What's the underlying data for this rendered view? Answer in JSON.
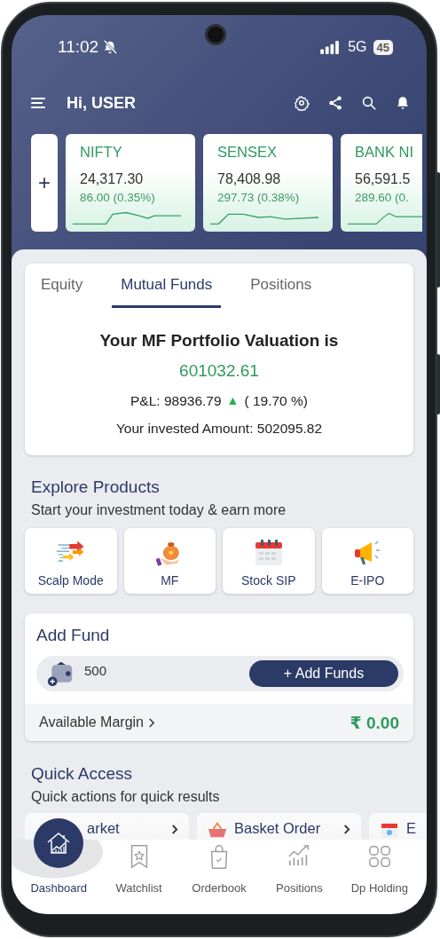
{
  "status_bar": {
    "time": "11:02",
    "network": "5G",
    "battery": "45"
  },
  "header": {
    "greeting": "Hi, USER"
  },
  "indices": [
    {
      "name": "NIFTY",
      "value": "24,317.30",
      "change": "86.00 (0.35%)"
    },
    {
      "name": "SENSEX",
      "value": "78,408.98",
      "change": "297.73 (0.38%)"
    },
    {
      "name": "BANK NI",
      "value": "56,591.5",
      "change": "289.60 (0."
    }
  ],
  "add_index": {
    "label": "+"
  },
  "portfolio": {
    "tabs": [
      {
        "label": "Equity",
        "selected": false
      },
      {
        "label": "Mutual Funds",
        "selected": true
      },
      {
        "label": "Positions",
        "selected": false
      }
    ],
    "title": "Your MF Portfolio Valuation is",
    "valuation": "601032.61",
    "pnl_label": "P&L: 98936.79",
    "pnl_arrow": "▲",
    "pnl_percent": "( 19.70 %)",
    "invested": "Your invested Amount: 502095.82"
  },
  "explore": {
    "title": "Explore Products",
    "subtitle": "Start your investment today & earn more",
    "products": [
      {
        "label": "Scalp Mode"
      },
      {
        "label": "MF"
      },
      {
        "label": "Stock SIP"
      },
      {
        "label": "E-IPO"
      }
    ]
  },
  "add_fund": {
    "title": "Add Fund",
    "amount": "500",
    "button": "+ Add Funds",
    "margin_label": "Available Margin",
    "margin_value": "₹ 0.00"
  },
  "quick_access": {
    "title": "Quick Access",
    "subtitle": "Quick actions for quick results",
    "items": [
      {
        "label": "arket"
      },
      {
        "label": "Basket Order"
      },
      {
        "label": "E"
      }
    ]
  },
  "nav": [
    {
      "label": "Dashboard",
      "selected": true
    },
    {
      "label": "Watchlist",
      "selected": false
    },
    {
      "label": "Orderbook",
      "selected": false
    },
    {
      "label": "Positions",
      "selected": false
    },
    {
      "label": "Dp Holding",
      "selected": false
    }
  ]
}
